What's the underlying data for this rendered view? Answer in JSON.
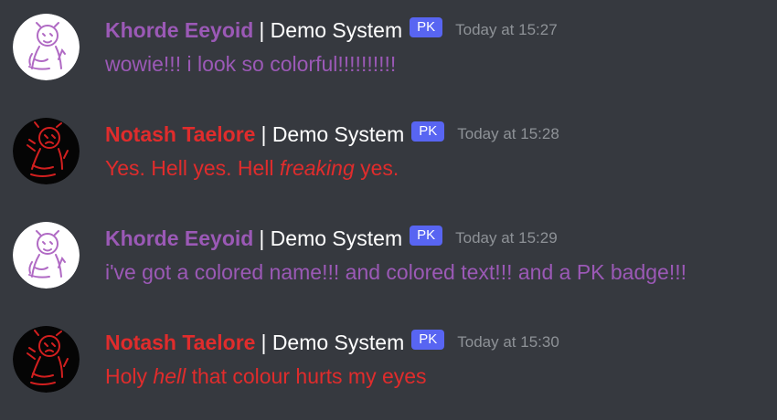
{
  "colors": {
    "background": "#36393f",
    "khorde": "#9b59b6",
    "notash": "#e02c2c",
    "badge": "#5865f2",
    "timestamp": "#8e9297"
  },
  "messages": [
    {
      "author": "Khorde Eeyoid",
      "system": "| Demo System",
      "badge": "PK",
      "timestamp": "Today at 15:27",
      "avatar_icon": "purple-sketch-avatar-icon",
      "content_before": "wowie!!! i look so colorful!!!!!!!!!!",
      "content_emphasis": "",
      "content_after": ""
    },
    {
      "author": "Notash Taelore",
      "system": "| Demo System",
      "badge": "PK",
      "timestamp": "Today at 15:28",
      "avatar_icon": "red-sketch-avatar-icon",
      "content_before": "Yes. Hell yes. Hell ",
      "content_emphasis": "freaking",
      "content_after": " yes."
    },
    {
      "author": "Khorde Eeyoid",
      "system": "| Demo System",
      "badge": "PK",
      "timestamp": "Today at 15:29",
      "avatar_icon": "purple-sketch-avatar-icon",
      "content_before": "i've got a colored name!!! and colored text!!! and a PK badge!!!",
      "content_emphasis": "",
      "content_after": ""
    },
    {
      "author": "Notash Taelore",
      "system": "| Demo System",
      "badge": "PK",
      "timestamp": "Today at 15:30",
      "avatar_icon": "red-sketch-avatar-icon",
      "content_before": "Holy ",
      "content_emphasis": "hell",
      "content_after": " that colour hurts my eyes"
    }
  ]
}
